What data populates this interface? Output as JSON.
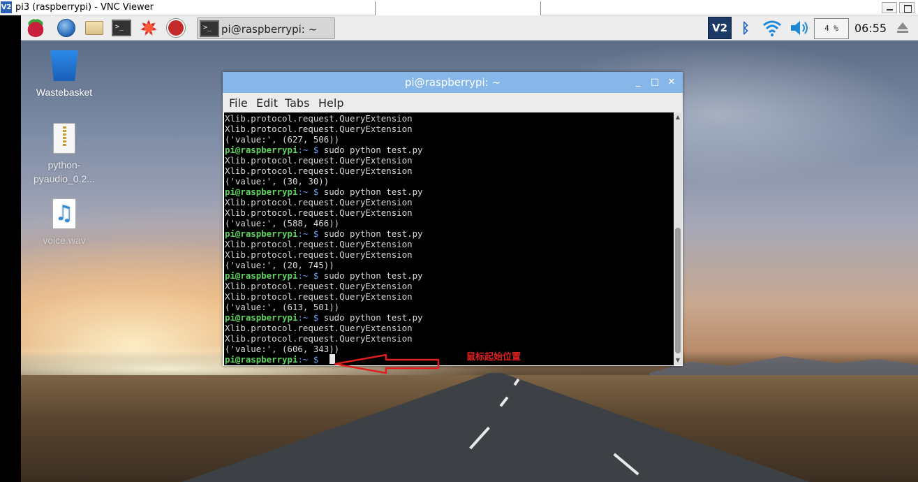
{
  "vnc": {
    "logo": "V2",
    "title": "pi3 (raspberrypi) - VNC Viewer"
  },
  "taskbar": {
    "task_label": "pi@raspberrypi: ~",
    "tray_vnc": "V2",
    "cpu": "4 %",
    "clock": "06:55"
  },
  "desktop_icons": [
    {
      "label": "Wastebasket"
    },
    {
      "label": "python-\npyaudio_0.2..."
    },
    {
      "label": "voice.wav"
    }
  ],
  "terminal": {
    "title": "pi@raspberrypi: ~",
    "menu": [
      "File",
      "Edit",
      "Tabs",
      "Help"
    ],
    "prompt_user": "pi@raspberrypi",
    "prompt_path": ":~ $ ",
    "command": "sudo python test.py",
    "lines": [
      {
        "type": "out",
        "text": "Xlib.protocol.request.QueryExtension"
      },
      {
        "type": "out",
        "text": "Xlib.protocol.request.QueryExtension"
      },
      {
        "type": "out",
        "text": "('value:', (627, 506))"
      },
      {
        "type": "cmd",
        "text": "sudo python test.py"
      },
      {
        "type": "out",
        "text": "Xlib.protocol.request.QueryExtension"
      },
      {
        "type": "out",
        "text": "Xlib.protocol.request.QueryExtension"
      },
      {
        "type": "out",
        "text": "('value:', (30, 30))"
      },
      {
        "type": "cmd",
        "text": "sudo python test.py"
      },
      {
        "type": "out",
        "text": "Xlib.protocol.request.QueryExtension"
      },
      {
        "type": "out",
        "text": "Xlib.protocol.request.QueryExtension"
      },
      {
        "type": "out",
        "text": "('value:', (588, 466))"
      },
      {
        "type": "cmd",
        "text": "sudo python test.py"
      },
      {
        "type": "out",
        "text": "Xlib.protocol.request.QueryExtension"
      },
      {
        "type": "out",
        "text": "Xlib.protocol.request.QueryExtension"
      },
      {
        "type": "out",
        "text": "('value:', (20, 745))"
      },
      {
        "type": "cmd",
        "text": "sudo python test.py"
      },
      {
        "type": "out",
        "text": "Xlib.protocol.request.QueryExtension"
      },
      {
        "type": "out",
        "text": "Xlib.protocol.request.QueryExtension"
      },
      {
        "type": "out",
        "text": "('value:', (613, 501))"
      },
      {
        "type": "cmd",
        "text": "sudo python test.py"
      },
      {
        "type": "out",
        "text": "Xlib.protocol.request.QueryExtension"
      },
      {
        "type": "out",
        "text": "Xlib.protocol.request.QueryExtension"
      },
      {
        "type": "out",
        "text": "('value:', (606, 343))"
      },
      {
        "type": "prompt",
        "text": ""
      }
    ]
  },
  "annotation": {
    "text": "鼠标起始位置",
    "color": "#e02020"
  }
}
